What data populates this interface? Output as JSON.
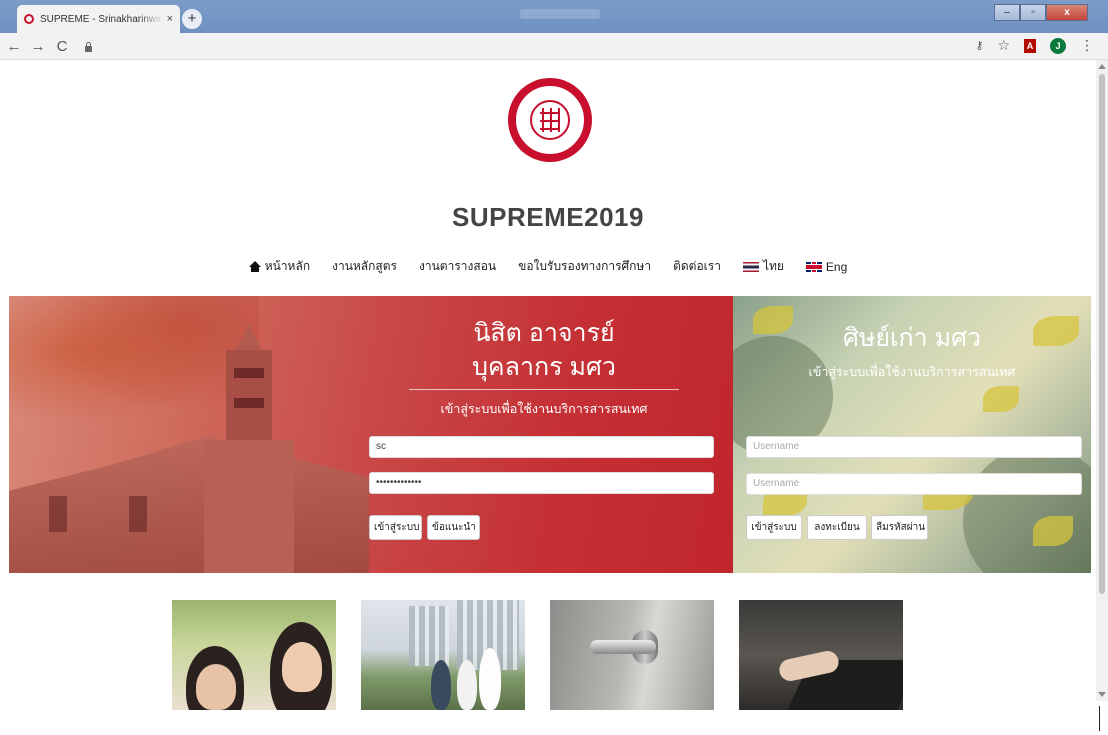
{
  "browser": {
    "tab_title": "SUPREME - Srinakharinwirot Univ",
    "tab_close": "×",
    "new_tab": "+",
    "back": "←",
    "forward": "→",
    "reload": "C",
    "avatar_letter": "J",
    "pdf_label": "A"
  },
  "site": {
    "brand": "SUPREME2019",
    "accent_color": "#c8102e"
  },
  "nav": {
    "items": [
      {
        "label": "หน้าหลัก",
        "icon": "home-icon"
      },
      {
        "label": "งานหลักสูตร"
      },
      {
        "label": "งานตารางสอน"
      },
      {
        "label": "ขอใบรับรองทางการศึกษา"
      },
      {
        "label": "ติดต่อเรา"
      },
      {
        "label": "ไทย",
        "icon": "flag-th-icon"
      },
      {
        "label": "Eng",
        "icon": "flag-uk-icon"
      }
    ]
  },
  "staff_login": {
    "title_line1": "นิสิต อาจารย์",
    "title_line2": "บุคลากร มศว",
    "subtitle": "เข้าสู่ระบบเพื่อใช้งานบริการสารสนเทศ",
    "username_value": "sc",
    "password_value": "•••••••••••••",
    "login_button": "เข้าสู่ระบบ",
    "help_button": "ข้อแนะนำ"
  },
  "alumni_login": {
    "title": "ศิษย์เก่า มศว",
    "subtitle": "เข้าสู่ระบบเพื่อใช้งานบริการสารสนเทศ",
    "username_placeholder": "Username",
    "password_placeholder": "Username",
    "login_button": "เข้าสู่ระบบ",
    "register_button": "ลงทะเบียน",
    "forgot_button": "ลืมรหัสผ่าน"
  }
}
